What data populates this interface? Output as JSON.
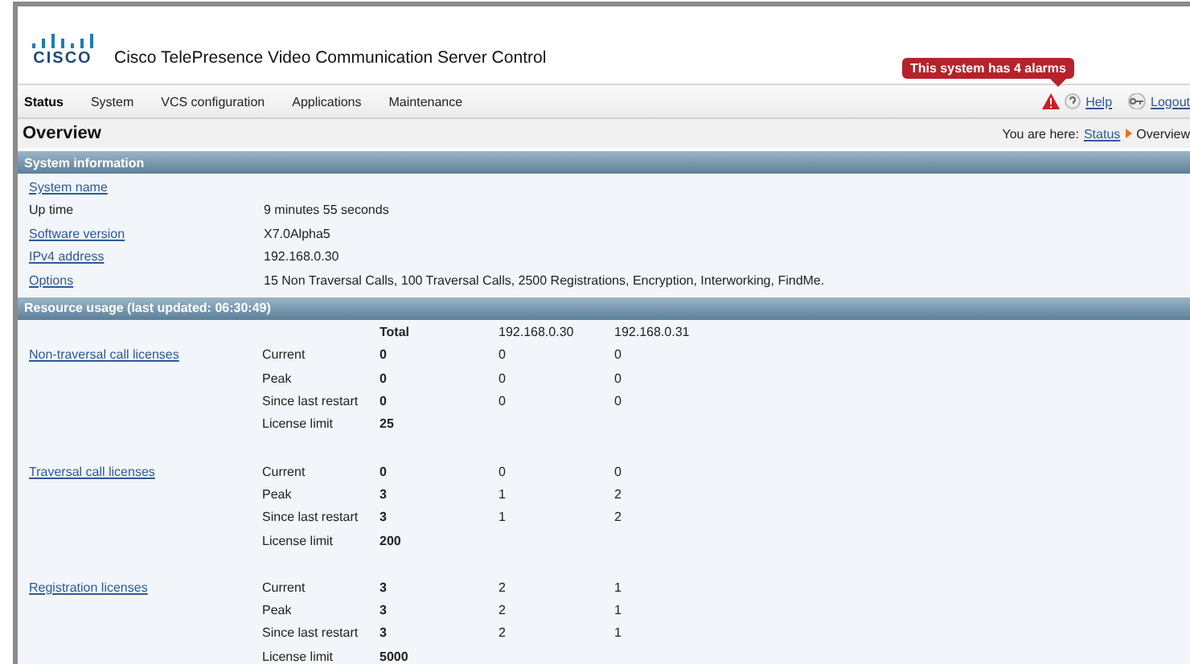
{
  "header": {
    "logo_text": "CISCO",
    "title": "Cisco TelePresence  Video Communication Server Control"
  },
  "nav": [
    {
      "label": "Status",
      "selected": true
    },
    {
      "label": "System",
      "selected": false
    },
    {
      "label": "VCS configuration",
      "selected": false
    },
    {
      "label": "Applications",
      "selected": false
    },
    {
      "label": "Maintenance",
      "selected": false
    }
  ],
  "alarm_tooltip": "This system has 4 alarms",
  "help_link": "Help",
  "logout_link": "Logout",
  "page_title": "Overview",
  "breadcrumb": {
    "prefix": "You are here:",
    "link": "Status",
    "current": "Overview"
  },
  "system_information": {
    "heading": "System information",
    "rows": [
      {
        "label": "System name",
        "link": true,
        "value": ""
      },
      {
        "label": "Up time",
        "link": false,
        "value": "9 minutes 55 seconds"
      },
      {
        "label": "Software version",
        "link": true,
        "value": "X7.0Alpha5"
      },
      {
        "label": "IPv4 address",
        "link": true,
        "value": "192.168.0.30"
      },
      {
        "label": "Options",
        "link": true,
        "value": "15 Non Traversal Calls, 100 Traversal Calls, 2500 Registrations, Encryption, Interworking, FindMe."
      }
    ]
  },
  "resource_usage": {
    "heading": "Resource usage (last updated: 06:30:49)",
    "columns": [
      "Total",
      "192.168.0.30",
      "192.168.0.31"
    ],
    "groups": [
      {
        "label": "Non-traversal call licenses",
        "rows": [
          {
            "label": "Current",
            "total": "0",
            "values": [
              "0",
              "0"
            ]
          },
          {
            "label": "Peak",
            "total": "0",
            "values": [
              "0",
              "0"
            ]
          },
          {
            "label": "Since last restart",
            "total": "0",
            "values": [
              "0",
              "0"
            ]
          },
          {
            "label": "License limit",
            "total": "25",
            "values": []
          }
        ]
      },
      {
        "label": "Traversal call licenses",
        "rows": [
          {
            "label": "Current",
            "total": "0",
            "values": [
              "0",
              "0"
            ]
          },
          {
            "label": "Peak",
            "total": "3",
            "values": [
              "1",
              "2"
            ]
          },
          {
            "label": "Since last restart",
            "total": "3",
            "values": [
              "1",
              "2"
            ]
          },
          {
            "label": "License limit",
            "total": "200",
            "values": []
          }
        ]
      },
      {
        "label": "Registration licenses",
        "rows": [
          {
            "label": "Current",
            "total": "3",
            "values": [
              "2",
              "1"
            ]
          },
          {
            "label": "Peak",
            "total": "3",
            "values": [
              "2",
              "1"
            ]
          },
          {
            "label": "Since last restart",
            "total": "3",
            "values": [
              "2",
              "1"
            ]
          },
          {
            "label": "License limit",
            "total": "5000",
            "values": []
          }
        ]
      }
    ]
  }
}
